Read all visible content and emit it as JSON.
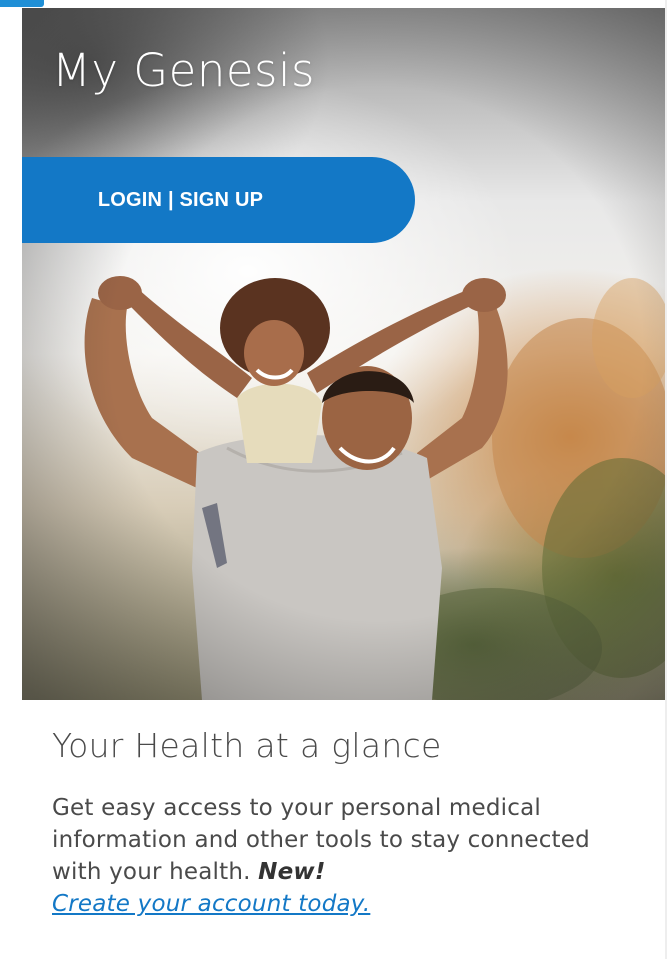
{
  "hero": {
    "title": "My Genesis",
    "login_button": "LOGIN | SIGN UP",
    "image": "father-and-daughter-photo"
  },
  "info": {
    "heading": "Your Health at a glance",
    "body": "Get easy access to your personal medical information and other tools to stay connected with your health.",
    "new_label": "New!",
    "create_link": "Create your account today."
  },
  "colors": {
    "accent": "#1378c6",
    "text": "#4a4a4a"
  }
}
